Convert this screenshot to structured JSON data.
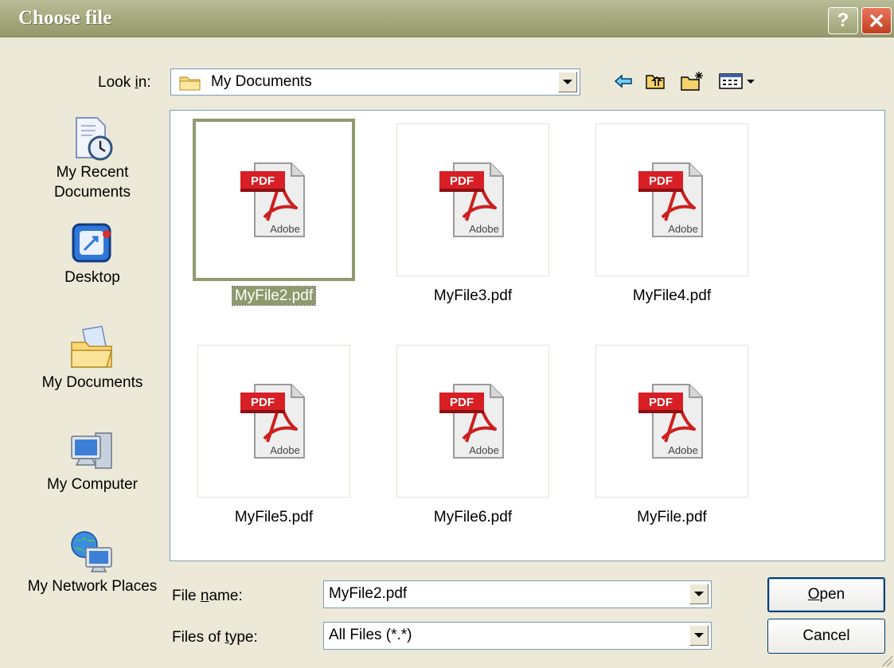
{
  "window": {
    "title": "Choose file",
    "help_icon": "help-icon",
    "close_icon": "close-icon"
  },
  "lookin": {
    "label": "Look in:",
    "value": "My Documents",
    "icon": "folder-icon"
  },
  "toolbar": {
    "buttons": [
      {
        "name": "back-icon"
      },
      {
        "name": "up-folder-icon"
      },
      {
        "name": "new-folder-icon"
      },
      {
        "name": "views-menu-icon"
      }
    ]
  },
  "places": [
    {
      "label": "My Recent Documents",
      "icon": "recent-documents-icon"
    },
    {
      "label": "Desktop",
      "icon": "desktop-icon"
    },
    {
      "label": "My Documents",
      "icon": "my-documents-icon"
    },
    {
      "label": "My Computer",
      "icon": "my-computer-icon"
    },
    {
      "label": "My Network Places",
      "icon": "network-places-icon"
    }
  ],
  "files": [
    {
      "name": "MyFile2.pdf",
      "selected": true
    },
    {
      "name": "MyFile3.pdf",
      "selected": false
    },
    {
      "name": "MyFile4.pdf",
      "selected": false
    },
    {
      "name": "MyFile5.pdf",
      "selected": false
    },
    {
      "name": "MyFile6.pdf",
      "selected": false
    },
    {
      "name": "MyFile.pdf",
      "selected": false
    }
  ],
  "pdf_icon": {
    "badge": "PDF",
    "brand": "Adobe"
  },
  "filename": {
    "label": "File name:",
    "value": "MyFile2.pdf"
  },
  "filetype": {
    "label": "Files of type:",
    "value": "All Files (*.*)"
  },
  "buttons": {
    "open": "Open",
    "cancel": "Cancel"
  },
  "colors": {
    "title_bar": "#a6ab7f",
    "selection": "#8c9a6c",
    "dialog_bg": "#ece9d8",
    "close": "#c1401f"
  }
}
